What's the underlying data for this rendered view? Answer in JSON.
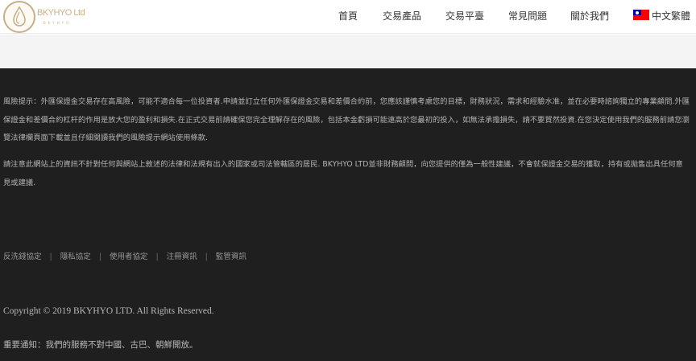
{
  "header": {
    "brand": "BKYHYO Ltd",
    "brand_sub": "BKYHYO",
    "nav": [
      {
        "label": "首頁"
      },
      {
        "label": "交易產品"
      },
      {
        "label": "交易平臺"
      },
      {
        "label": "常見問題"
      },
      {
        "label": "關於我們"
      }
    ],
    "language": "中文繁體",
    "flag_icon": "taiwan-flag-icon",
    "colors": {
      "brand": "#c8b186",
      "footer_bg": "#1f1f1f"
    }
  },
  "footer": {
    "risk_paragraph": "風險提示：外匯保證金交易存在高風險，可能不適合每一位投資者.申請並訂立任何外匯保證金交易和差價合約前，您應該謹慎考慮您的目標，財務狀況，需求和經驗水准，並在必要時諮詢獨立的專業顧問.外匯保證金和差價合約杠杆的作用是放大您的盈利和損失.在正式交易前請確保您完全理解存在的風險，包括本金虧損可能遠高於您最初的投入，如無法承擔損失，請不要貿然投資.在您決定使用我們的服務前請您瀏覽法律欄頁面下載並且仔細閱讀我們的風險提示網站使用條款.",
    "notice_paragraph": "請注意此網站上的資訊不針對任何與網站上敘述的法律和法規有出入的國家或司法管轄區的居民. BKYHYO LTD並非財務顧問，向您提供的僅為一般性建議，不會就保證金交易的獲取，持有或拋售出具任何意見或建議.",
    "links": [
      {
        "label": "反洗錢協定"
      },
      {
        "label": "隱私協定"
      },
      {
        "label": "使用者協定"
      },
      {
        "label": "注冊資訊"
      },
      {
        "label": "監管資訊"
      }
    ],
    "link_separator": "|",
    "copyright": "Copyright © 2019 BKYHYO LTD. All Rights Reserved.",
    "important_notice": "重要通知：我們的服務不對中國、古巴、朝鮮開放。"
  }
}
